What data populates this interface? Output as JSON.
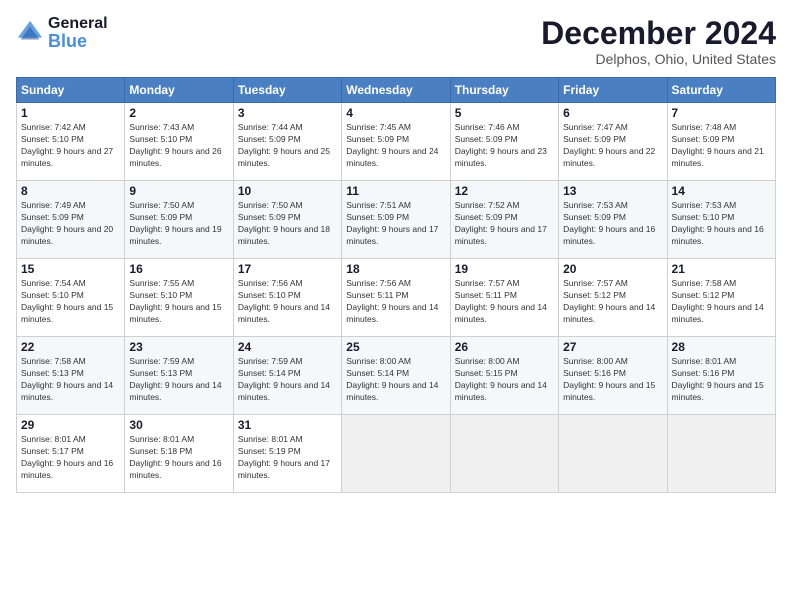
{
  "header": {
    "logo_general": "General",
    "logo_blue": "Blue",
    "month_title": "December 2024",
    "location": "Delphos, Ohio, United States"
  },
  "weekdays": [
    "Sunday",
    "Monday",
    "Tuesday",
    "Wednesday",
    "Thursday",
    "Friday",
    "Saturday"
  ],
  "weeks": [
    [
      {
        "day": "1",
        "sunrise": "7:42 AM",
        "sunset": "5:10 PM",
        "daylight": "9 hours and 27 minutes."
      },
      {
        "day": "2",
        "sunrise": "7:43 AM",
        "sunset": "5:10 PM",
        "daylight": "9 hours and 26 minutes."
      },
      {
        "day": "3",
        "sunrise": "7:44 AM",
        "sunset": "5:09 PM",
        "daylight": "9 hours and 25 minutes."
      },
      {
        "day": "4",
        "sunrise": "7:45 AM",
        "sunset": "5:09 PM",
        "daylight": "9 hours and 24 minutes."
      },
      {
        "day": "5",
        "sunrise": "7:46 AM",
        "sunset": "5:09 PM",
        "daylight": "9 hours and 23 minutes."
      },
      {
        "day": "6",
        "sunrise": "7:47 AM",
        "sunset": "5:09 PM",
        "daylight": "9 hours and 22 minutes."
      },
      {
        "day": "7",
        "sunrise": "7:48 AM",
        "sunset": "5:09 PM",
        "daylight": "9 hours and 21 minutes."
      }
    ],
    [
      {
        "day": "8",
        "sunrise": "7:49 AM",
        "sunset": "5:09 PM",
        "daylight": "9 hours and 20 minutes."
      },
      {
        "day": "9",
        "sunrise": "7:50 AM",
        "sunset": "5:09 PM",
        "daylight": "9 hours and 19 minutes."
      },
      {
        "day": "10",
        "sunrise": "7:50 AM",
        "sunset": "5:09 PM",
        "daylight": "9 hours and 18 minutes."
      },
      {
        "day": "11",
        "sunrise": "7:51 AM",
        "sunset": "5:09 PM",
        "daylight": "9 hours and 17 minutes."
      },
      {
        "day": "12",
        "sunrise": "7:52 AM",
        "sunset": "5:09 PM",
        "daylight": "9 hours and 17 minutes."
      },
      {
        "day": "13",
        "sunrise": "7:53 AM",
        "sunset": "5:09 PM",
        "daylight": "9 hours and 16 minutes."
      },
      {
        "day": "14",
        "sunrise": "7:53 AM",
        "sunset": "5:10 PM",
        "daylight": "9 hours and 16 minutes."
      }
    ],
    [
      {
        "day": "15",
        "sunrise": "7:54 AM",
        "sunset": "5:10 PM",
        "daylight": "9 hours and 15 minutes."
      },
      {
        "day": "16",
        "sunrise": "7:55 AM",
        "sunset": "5:10 PM",
        "daylight": "9 hours and 15 minutes."
      },
      {
        "day": "17",
        "sunrise": "7:56 AM",
        "sunset": "5:10 PM",
        "daylight": "9 hours and 14 minutes."
      },
      {
        "day": "18",
        "sunrise": "7:56 AM",
        "sunset": "5:11 PM",
        "daylight": "9 hours and 14 minutes."
      },
      {
        "day": "19",
        "sunrise": "7:57 AM",
        "sunset": "5:11 PM",
        "daylight": "9 hours and 14 minutes."
      },
      {
        "day": "20",
        "sunrise": "7:57 AM",
        "sunset": "5:12 PM",
        "daylight": "9 hours and 14 minutes."
      },
      {
        "day": "21",
        "sunrise": "7:58 AM",
        "sunset": "5:12 PM",
        "daylight": "9 hours and 14 minutes."
      }
    ],
    [
      {
        "day": "22",
        "sunrise": "7:58 AM",
        "sunset": "5:13 PM",
        "daylight": "9 hours and 14 minutes."
      },
      {
        "day": "23",
        "sunrise": "7:59 AM",
        "sunset": "5:13 PM",
        "daylight": "9 hours and 14 minutes."
      },
      {
        "day": "24",
        "sunrise": "7:59 AM",
        "sunset": "5:14 PM",
        "daylight": "9 hours and 14 minutes."
      },
      {
        "day": "25",
        "sunrise": "8:00 AM",
        "sunset": "5:14 PM",
        "daylight": "9 hours and 14 minutes."
      },
      {
        "day": "26",
        "sunrise": "8:00 AM",
        "sunset": "5:15 PM",
        "daylight": "9 hours and 14 minutes."
      },
      {
        "day": "27",
        "sunrise": "8:00 AM",
        "sunset": "5:16 PM",
        "daylight": "9 hours and 15 minutes."
      },
      {
        "day": "28",
        "sunrise": "8:01 AM",
        "sunset": "5:16 PM",
        "daylight": "9 hours and 15 minutes."
      }
    ],
    [
      {
        "day": "29",
        "sunrise": "8:01 AM",
        "sunset": "5:17 PM",
        "daylight": "9 hours and 16 minutes."
      },
      {
        "day": "30",
        "sunrise": "8:01 AM",
        "sunset": "5:18 PM",
        "daylight": "9 hours and 16 minutes."
      },
      {
        "day": "31",
        "sunrise": "8:01 AM",
        "sunset": "5:19 PM",
        "daylight": "9 hours and 17 minutes."
      },
      null,
      null,
      null,
      null
    ]
  ],
  "labels": {
    "sunrise": "Sunrise:",
    "sunset": "Sunset:",
    "daylight": "Daylight:"
  }
}
